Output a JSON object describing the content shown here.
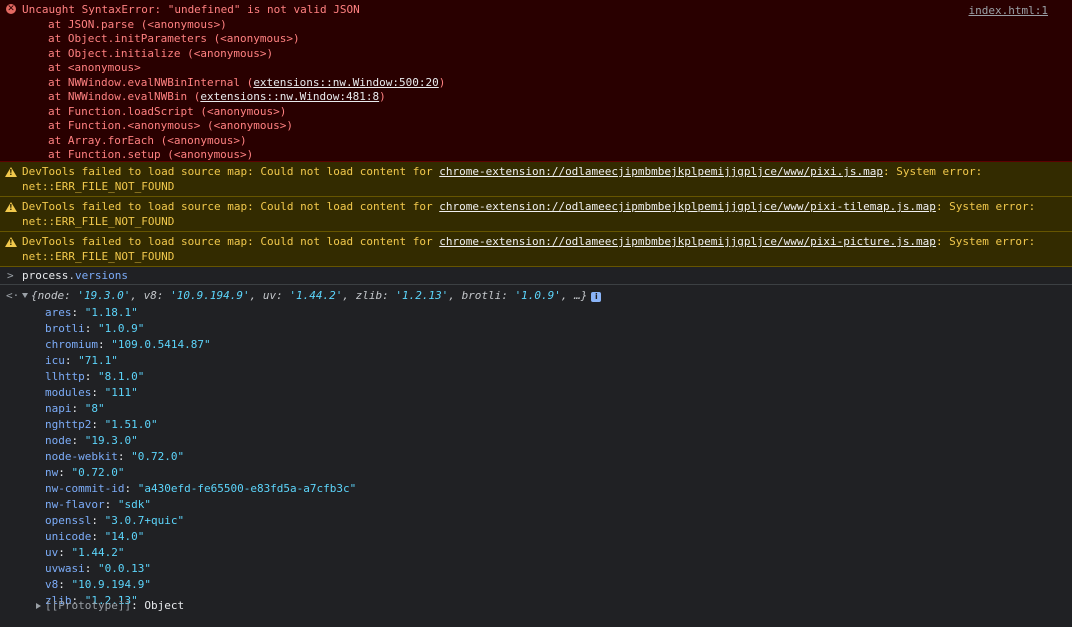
{
  "error": {
    "message": "Uncaught SyntaxError: \"undefined\" is not valid JSON",
    "source": "index.html:1",
    "stack": [
      {
        "text": "at JSON.parse (<anonymous>)"
      },
      {
        "text": "at Object.initParameters (<anonymous>)"
      },
      {
        "text": "at Object.initialize (<anonymous>)"
      },
      {
        "text": "at <anonymous>"
      },
      {
        "prefix": "at NWWindow.evalNWBinInternal (",
        "link": "extensions::nw.Window:500:20",
        "suffix": ")"
      },
      {
        "prefix": "at NWWindow.evalNWBin (",
        "link": "extensions::nw.Window:481:8",
        "suffix": ")"
      },
      {
        "text": "at Function.loadScript (<anonymous>)"
      },
      {
        "text": "at Function.<anonymous> (<anonymous>)"
      },
      {
        "text": "at Array.forEach (<anonymous>)"
      },
      {
        "text": "at Function.setup (<anonymous>)"
      }
    ]
  },
  "warnings": [
    {
      "prefix": "DevTools failed to load source map: Could not load content for ",
      "link": "chrome-extension://odlameecjipmbmbejkplpemijjgpljce/www/pixi.js.map",
      "suffix": ": System error: net::ERR_FILE_NOT_FOUND"
    },
    {
      "prefix": "DevTools failed to load source map: Could not load content for ",
      "link": "chrome-extension://odlameecjipmbmbejkplpemijjgpljce/www/pixi-tilemap.js.map",
      "suffix": ": System error: net::ERR_FILE_NOT_FOUND"
    },
    {
      "prefix": "DevTools failed to load source map: Could not load content for ",
      "link": "chrome-extension://odlameecjipmbmbejkplpemijjgpljce/www/pixi-picture.js.map",
      "suffix": ": System error: net::ERR_FILE_NOT_FOUND"
    }
  ],
  "input": {
    "object": "process",
    "dot": ".",
    "prop": "versions"
  },
  "summary": {
    "open": "{",
    "pairs": [
      {
        "k": "node",
        "v": "'19.3.0'"
      },
      {
        "k": "v8",
        "v": "'10.9.194.9'"
      },
      {
        "k": "uv",
        "v": "'1.44.2'"
      },
      {
        "k": "zlib",
        "v": "'1.2.13'"
      },
      {
        "k": "brotli",
        "v": "'1.0.9'"
      }
    ],
    "ellipsis": ", …}",
    "info": "i"
  },
  "props": [
    {
      "k": "ares",
      "v": "\"1.18.1\""
    },
    {
      "k": "brotli",
      "v": "\"1.0.9\""
    },
    {
      "k": "chromium",
      "v": "\"109.0.5414.87\""
    },
    {
      "k": "icu",
      "v": "\"71.1\""
    },
    {
      "k": "llhttp",
      "v": "\"8.1.0\""
    },
    {
      "k": "modules",
      "v": "\"111\""
    },
    {
      "k": "napi",
      "v": "\"8\""
    },
    {
      "k": "nghttp2",
      "v": "\"1.51.0\""
    },
    {
      "k": "node",
      "v": "\"19.3.0\""
    },
    {
      "k": "node-webkit",
      "v": "\"0.72.0\""
    },
    {
      "k": "nw",
      "v": "\"0.72.0\""
    },
    {
      "k": "nw-commit-id",
      "v": "\"a430efd-fe65500-e83fd5a-a7cfb3c\""
    },
    {
      "k": "nw-flavor",
      "v": "\"sdk\""
    },
    {
      "k": "openssl",
      "v": "\"3.0.7+quic\""
    },
    {
      "k": "unicode",
      "v": "\"14.0\""
    },
    {
      "k": "uv",
      "v": "\"1.44.2\""
    },
    {
      "k": "uvwasi",
      "v": "\"0.0.13\""
    },
    {
      "k": "v8",
      "v": "\"10.9.194.9\""
    },
    {
      "k": "zlib",
      "v": "\"1.2.13\""
    }
  ],
  "prototype": {
    "key": "[[Prototype]]",
    "sep": ": ",
    "value": "Object"
  }
}
